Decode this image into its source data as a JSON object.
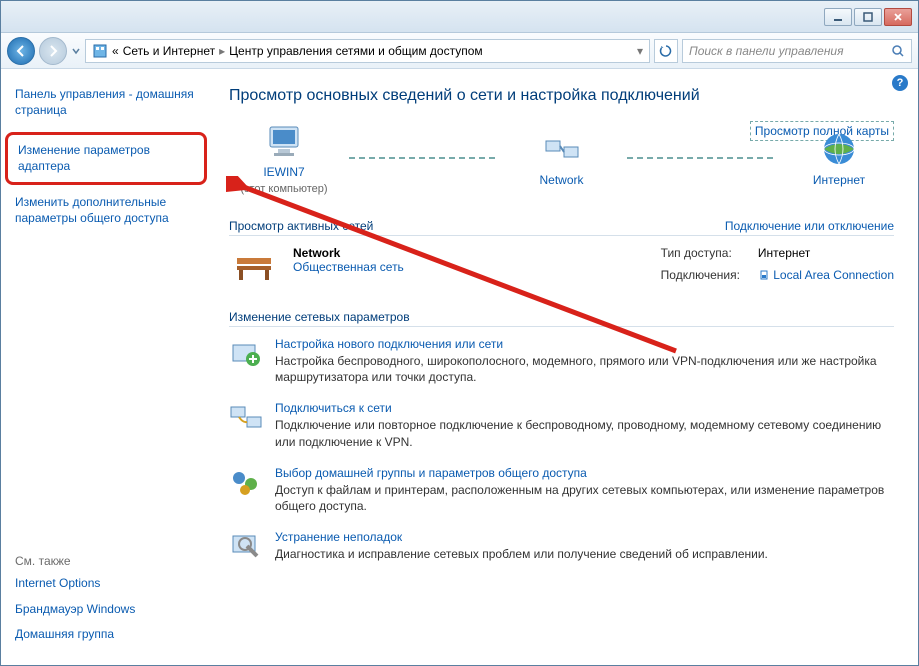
{
  "titlebar": {
    "minimize_name": "minimize",
    "maximize_name": "maximize",
    "close_name": "close"
  },
  "breadcrumb": {
    "prefix": "«",
    "part1": "Сеть и Интернет",
    "part2": "Центр управления сетями и общим доступом"
  },
  "search": {
    "placeholder": "Поиск в панели управления"
  },
  "sidebar": {
    "home": "Панель управления - домашняя страница",
    "adapter": "Изменение параметров адаптера",
    "advanced": "Изменить дополнительные параметры общего доступа",
    "seealso_title": "См. также",
    "seealso": [
      "Internet Options",
      "Брандмауэр Windows",
      "Домашняя группа"
    ]
  },
  "main": {
    "title": "Просмотр основных сведений о сети и настройка подключений",
    "maplink": "Просмотр полной карты",
    "nodes": {
      "this_pc": "IEWIN7",
      "this_pc_sub": "(этот компьютер)",
      "network": "Network",
      "internet": "Интернет"
    },
    "active_head": "Просмотр активных сетей",
    "active_rightlink": "Подключение или отключение",
    "active_net": {
      "name": "Network",
      "type": "Общественная сеть",
      "access_key": "Тип доступа:",
      "access_val": "Интернет",
      "conn_key": "Подключения:",
      "conn_val": "Local Area Connection"
    },
    "change_head": "Изменение сетевых параметров",
    "tasks": [
      {
        "link": "Настройка нового подключения или сети",
        "desc": "Настройка беспроводного, широкополосного, модемного, прямого или VPN-подключения или же настройка маршрутизатора или точки доступа."
      },
      {
        "link": "Подключиться к сети",
        "desc": "Подключение или повторное подключение к беспроводному, проводному, модемному сетевому соединению или подключение к VPN."
      },
      {
        "link": "Выбор домашней группы и параметров общего доступа",
        "desc": "Доступ к файлам и принтерам, расположенным на других сетевых компьютерах, или изменение параметров общего доступа."
      },
      {
        "link": "Устранение неполадок",
        "desc": "Диагностика и исправление сетевых проблем или получение сведений об исправлении."
      }
    ]
  }
}
